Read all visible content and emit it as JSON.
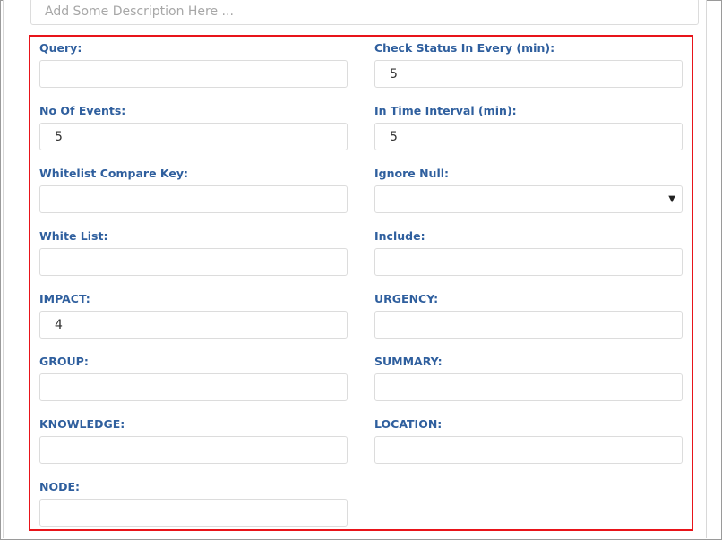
{
  "description": {
    "placeholder": "Add Some Description Here ..."
  },
  "fields": {
    "query": {
      "label": "Query:",
      "value": ""
    },
    "check_status": {
      "label": "Check Status In Every (min):",
      "value": "5"
    },
    "no_of_events": {
      "label": "No Of Events:",
      "value": "5"
    },
    "time_interval": {
      "label": "In Time Interval (min):",
      "value": "5"
    },
    "whitelist_key": {
      "label": "Whitelist Compare Key:",
      "value": ""
    },
    "ignore_null": {
      "label": "Ignore Null:",
      "value": ""
    },
    "white_list": {
      "label": "White List:",
      "value": ""
    },
    "include": {
      "label": "Include:",
      "value": ""
    },
    "impact": {
      "label": "IMPACT:",
      "value": "4"
    },
    "urgency": {
      "label": "URGENCY:",
      "value": ""
    },
    "group": {
      "label": "GROUP:",
      "value": ""
    },
    "summary": {
      "label": "SUMMARY:",
      "value": ""
    },
    "knowledge": {
      "label": "KNOWLEDGE:",
      "value": ""
    },
    "location": {
      "label": "LOCATION:",
      "value": ""
    },
    "node": {
      "label": "NODE:",
      "value": ""
    }
  },
  "icons": {
    "dropdown": "chevron-down-icon"
  },
  "colors": {
    "label": "#2f5f9e",
    "highlight_border": "#e8141a"
  }
}
